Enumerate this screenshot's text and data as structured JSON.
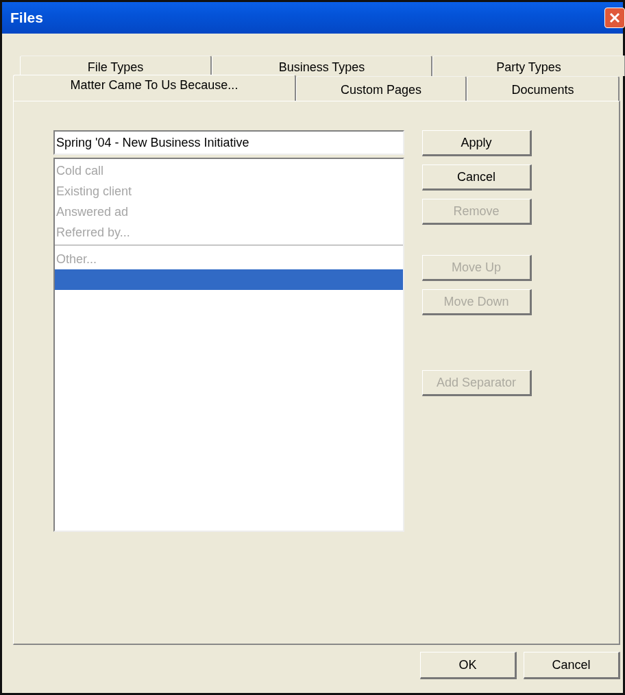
{
  "window": {
    "title": "Files"
  },
  "tab_rows": [
    [
      {
        "label": "File Types",
        "selected": false
      },
      {
        "label": "Business Types",
        "selected": false
      },
      {
        "label": "Party Types",
        "selected": false
      }
    ],
    [
      {
        "label": "Matter Came To Us Because...",
        "selected": true
      },
      {
        "label": "Custom Pages",
        "selected": false
      },
      {
        "label": "Documents",
        "selected": false
      }
    ]
  ],
  "name_field": {
    "value": "Spring '04 - New Business Initiative"
  },
  "list_items": [
    {
      "kind": "item",
      "label": "Cold call",
      "disabled": true,
      "selected": false
    },
    {
      "kind": "item",
      "label": "Existing client",
      "disabled": true,
      "selected": false
    },
    {
      "kind": "item",
      "label": "Answered ad",
      "disabled": true,
      "selected": false
    },
    {
      "kind": "item",
      "label": "Referred by...",
      "disabled": true,
      "selected": false
    },
    {
      "kind": "separator"
    },
    {
      "kind": "item",
      "label": "Other...",
      "disabled": true,
      "selected": false
    },
    {
      "kind": "blank",
      "selected": true
    }
  ],
  "side_button_groups": [
    [
      {
        "label": "Apply",
        "disabled": false
      },
      {
        "label": "Cancel",
        "disabled": false
      },
      {
        "label": "Remove",
        "disabled": true
      }
    ],
    [
      {
        "label": "Move Up",
        "disabled": true
      },
      {
        "label": "Move Down",
        "disabled": true
      }
    ],
    [
      {
        "label": "Add Separator",
        "disabled": true
      }
    ]
  ],
  "dialog_buttons": [
    {
      "label": "OK"
    },
    {
      "label": "Cancel"
    }
  ]
}
